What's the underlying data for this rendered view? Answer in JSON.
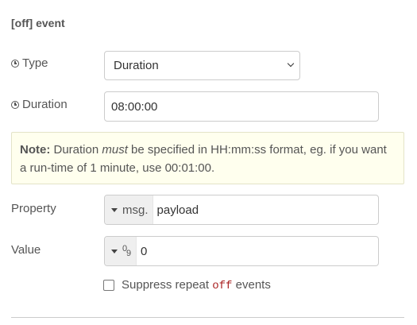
{
  "section": {
    "title": "[off] event"
  },
  "type_row": {
    "label": "Type",
    "selected": "Duration"
  },
  "duration_row": {
    "label": "Duration",
    "value": "08:00:00"
  },
  "note": {
    "bold": "Note:",
    "part1": " Duration ",
    "em": "must",
    "part2": " be specified in HH:mm:ss format, eg. if you want a run-time of 1 minute, use 00:01:00."
  },
  "property_row": {
    "label": "Property",
    "type_prefix": "msg.",
    "value": "payload"
  },
  "value_row": {
    "label": "Value",
    "type_icon_top": "0",
    "type_icon_bottom": "9",
    "value": "0"
  },
  "suppress": {
    "prefix": "Suppress repeat ",
    "keyword": "off",
    "suffix": " events"
  }
}
